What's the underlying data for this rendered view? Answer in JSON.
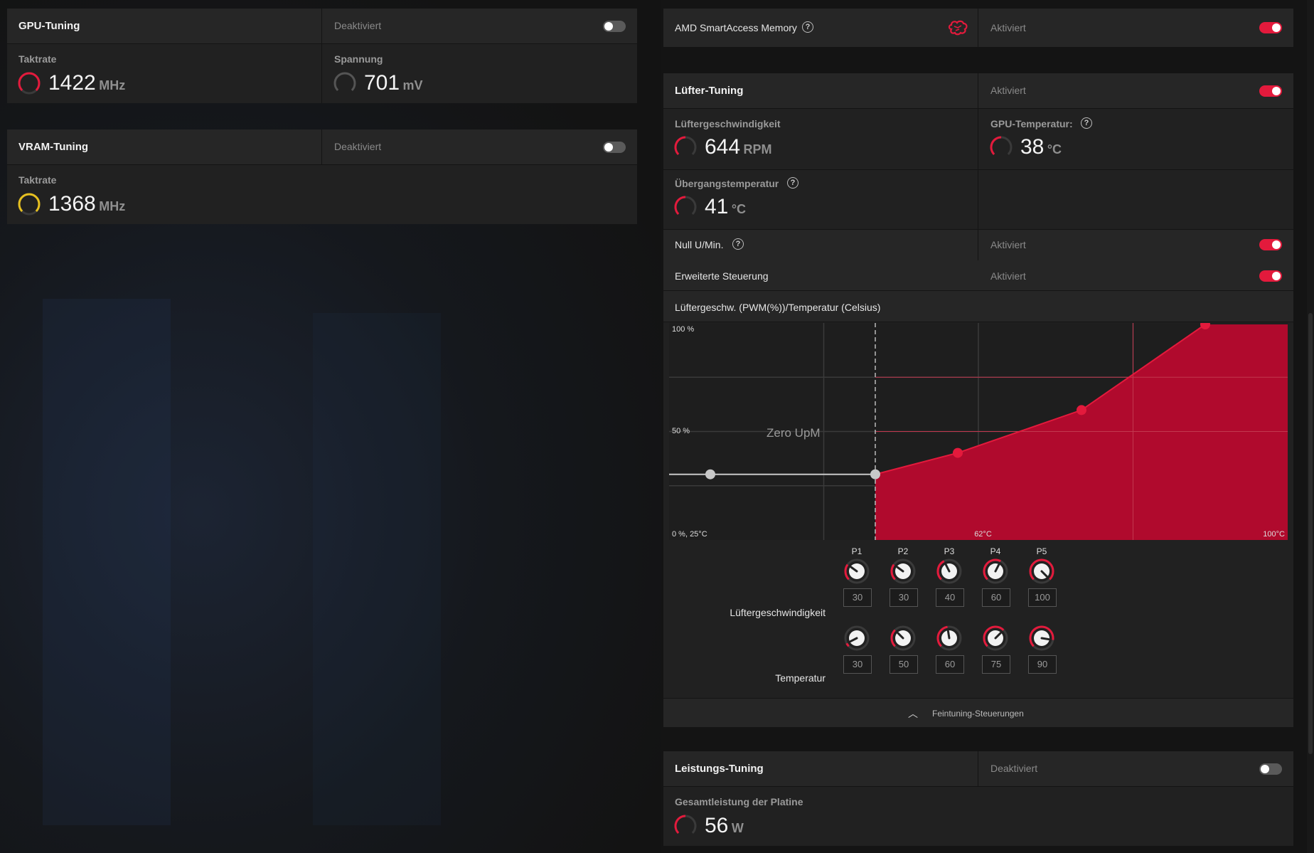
{
  "gpu_tuning": {
    "title": "GPU-Tuning",
    "status": "Deaktiviert",
    "clock_label": "Taktrate",
    "clock_value": "1422",
    "clock_unit": "MHz",
    "voltage_label": "Spannung",
    "voltage_value": "701",
    "voltage_unit": "mV"
  },
  "vram_tuning": {
    "title": "VRAM-Tuning",
    "status": "Deaktiviert",
    "clock_label": "Taktrate",
    "clock_value": "1368",
    "clock_unit": "MHz"
  },
  "smart_access": {
    "title": "AMD SmartAccess Memory",
    "status": "Aktiviert"
  },
  "fan_tuning": {
    "title": "Lüfter-Tuning",
    "status": "Aktiviert",
    "fan_speed_label": "Lüftergeschwindigkeit",
    "fan_speed_value": "644",
    "fan_speed_unit": "RPM",
    "gpu_temp_label": "GPU-Temperatur:",
    "gpu_temp_value": "38",
    "gpu_temp_unit": "°C",
    "junction_label": "Übergangstemperatur",
    "junction_value": "41",
    "junction_unit": "°C",
    "zero_rpm_label": "Null U/Min.",
    "zero_rpm_status": "Aktiviert",
    "advanced_label": "Erweiterte Steuerung",
    "advanced_status": "Aktiviert",
    "curve_title": "Lüftergeschw. (PWM(%))/Temperatur (Celsius)",
    "fine_tuning_label": "Feintuning-Steuerungen"
  },
  "chart_data": {
    "type": "area",
    "title": "Lüftergeschw. (PWM(%))/Temperatur (Celsius)",
    "x_labels": [
      "0 %, 25°C",
      "62°C",
      "100°C"
    ],
    "y_labels": [
      "100 %",
      "50 %"
    ],
    "annotation": "Zero UpM",
    "zero_rpm_threshold_c": 50,
    "xlim": [
      25,
      100
    ],
    "ylim": [
      0,
      100
    ],
    "points": [
      {
        "x": 30,
        "y": 30
      },
      {
        "x": 50,
        "y": 30
      },
      {
        "x": 60,
        "y": 40
      },
      {
        "x": 75,
        "y": 60
      },
      {
        "x": 90,
        "y": 100
      }
    ],
    "colors": {
      "fill": "#b00a2d",
      "line": "#e31a3c",
      "inactive": "#c8c8c8"
    }
  },
  "points": {
    "labels": [
      "P1",
      "P2",
      "P3",
      "P4",
      "P5"
    ],
    "fan_label": "Lüftergeschwindigkeit",
    "fan_values": [
      "30",
      "30",
      "40",
      "60",
      "100"
    ],
    "temp_label": "Temperatur",
    "temp_values": [
      "30",
      "50",
      "60",
      "75",
      "90"
    ]
  },
  "power_tuning": {
    "title": "Leistungs-Tuning",
    "status": "Deaktiviert",
    "board_power_label": "Gesamtleistung der Platine",
    "board_power_value": "56",
    "board_power_unit": "W"
  },
  "colors": {
    "accent": "#e31a3c",
    "vram_gauge": "#e6c020",
    "panel": "#212121",
    "header": "#262626"
  }
}
